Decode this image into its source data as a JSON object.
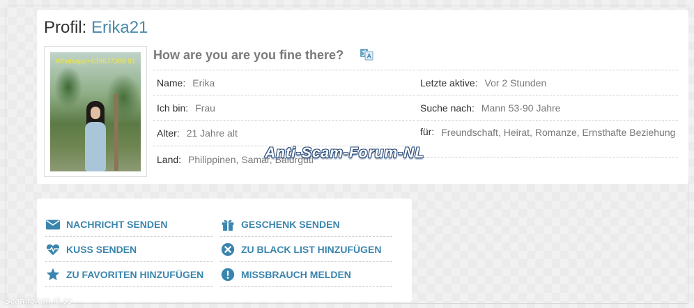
{
  "profile": {
    "title_prefix": "Profil:",
    "username": "Erika21",
    "photo_watermark": "Whatsapp+639677389 91",
    "headline": "How are you are you fine there?",
    "fields_left": [
      {
        "label": "Name:",
        "value": "Erika"
      },
      {
        "label": "Ich bin:",
        "value": "Frau"
      },
      {
        "label": "Alter:",
        "value": "21 Jahre alt"
      },
      {
        "label": "Land:",
        "value": "Philippinen, Samar, Balurguti"
      }
    ],
    "fields_right": [
      {
        "label": "Letzte aktive:",
        "value": "Vor 2 Stunden"
      },
      {
        "label": "Suche nach:",
        "value": "Mann 53-90 Jahre"
      },
      {
        "label": "für:",
        "value": "Freundschaft, Heirat, Romanze, Ernsthafte Beziehung"
      }
    ]
  },
  "actions": {
    "send_message": "NACHRICHT SENDEN",
    "send_gift": "GESCHENK SENDEN",
    "send_kiss": "KUSS SENDEN",
    "add_blacklist": "ZU BLACK LIST HINZUFÜGEN",
    "add_favorites": "ZU FAVORITEN HINZUFÜGEN",
    "report_abuse": "MISSBRAUCH MELDEN"
  },
  "overlay": {
    "banner": "Anti-Scam-Forum-NL",
    "site_mark": "Scamforum.nl.co"
  },
  "colors": {
    "accent": "#3a85ad",
    "username": "#4a8aab",
    "label": "#2f2f2f",
    "value": "#7a7a7a"
  },
  "icons": {
    "send_message": "envelope-icon",
    "send_gift": "gift-icon",
    "send_kiss": "heartbeat-icon",
    "add_blacklist": "x-circle-icon",
    "add_favorites": "star-icon",
    "report_abuse": "exclamation-circle-icon",
    "translate": "translate-icon"
  }
}
